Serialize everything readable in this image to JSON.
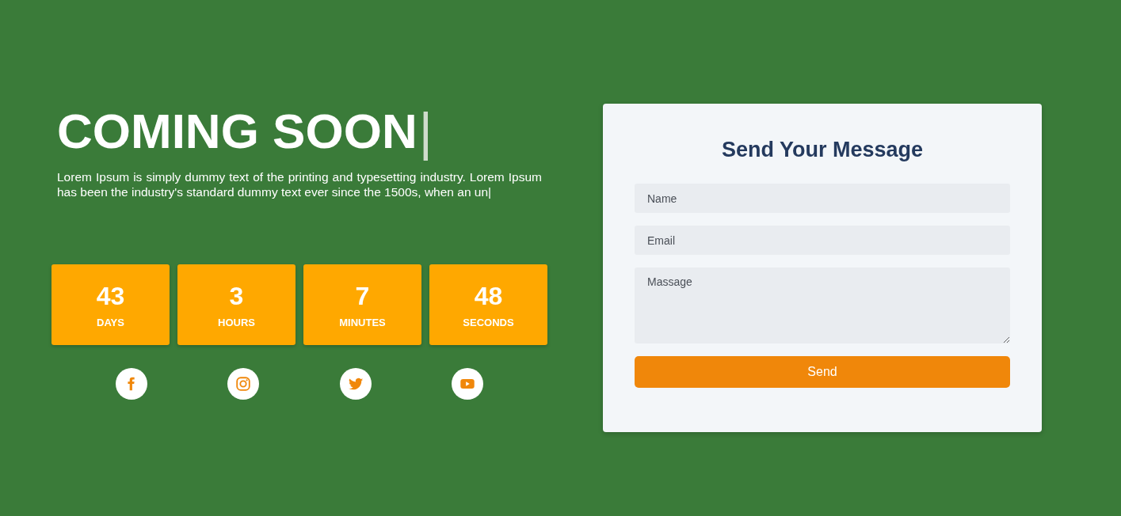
{
  "hero": {
    "title": "COMING SOON",
    "cursor": "|",
    "text": "Lorem Ipsum is simply dummy text of the printing and typesetting industry. Lorem Ipsum has been the industry's standard dummy text ever since the 1500s, when an un|"
  },
  "countdown": [
    {
      "value": "43",
      "unit": "DAYS"
    },
    {
      "value": "3",
      "unit": "HOURS"
    },
    {
      "value": "7",
      "unit": "MINUTES"
    },
    {
      "value": "48",
      "unit": "SECONDS"
    }
  ],
  "social": [
    {
      "kind": "facebook"
    },
    {
      "kind": "instagram"
    },
    {
      "kind": "twitter"
    },
    {
      "kind": "youtube"
    }
  ],
  "form": {
    "title": "Send Your Message",
    "fields": [
      {
        "kind": "input",
        "placeholder": "Name"
      },
      {
        "kind": "input",
        "placeholder": "Email"
      },
      {
        "kind": "textarea",
        "placeholder": "Massage"
      }
    ],
    "button": "Send"
  }
}
